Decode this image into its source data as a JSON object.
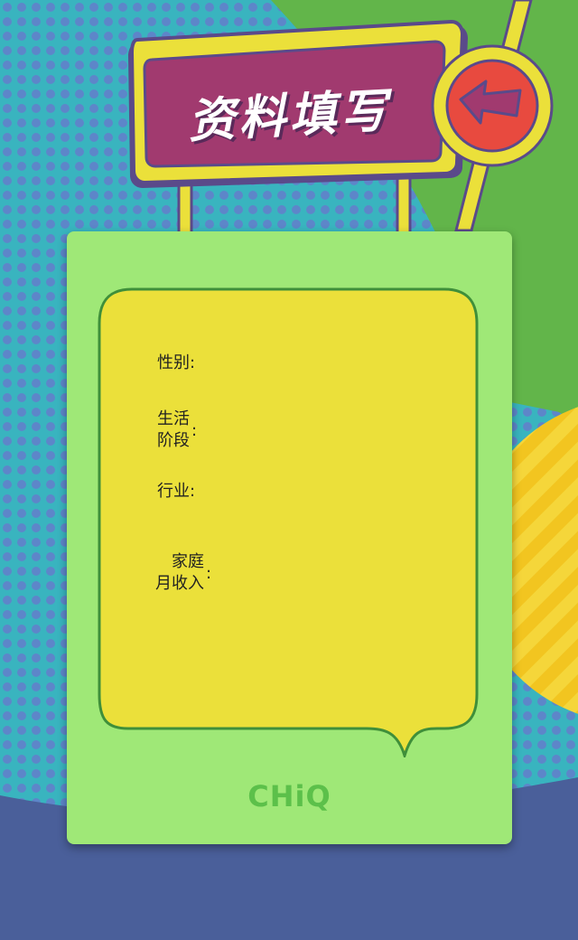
{
  "header": {
    "title": "资料填写",
    "back_icon": "back-arrow-icon"
  },
  "form": {
    "fields": [
      {
        "label_line1": "性别",
        "label_line2": "",
        "colon": ":"
      },
      {
        "label_line1": "生活",
        "label_line2": "阶段",
        "colon": ":"
      },
      {
        "label_line1": "行业",
        "label_line2": "",
        "colon": ":"
      },
      {
        "label_line1": "家庭",
        "label_line2": "月收入",
        "colon": ":"
      }
    ]
  },
  "footer": {
    "brand": "CHiQ"
  },
  "colors": {
    "teal": "#39b4bf",
    "green": "#62b54a",
    "yellow": "#ebe03a",
    "card": "#9fe877",
    "navy": "#4a5f9a",
    "sign": "#a13a6f",
    "button_red": "#e84a3f"
  }
}
